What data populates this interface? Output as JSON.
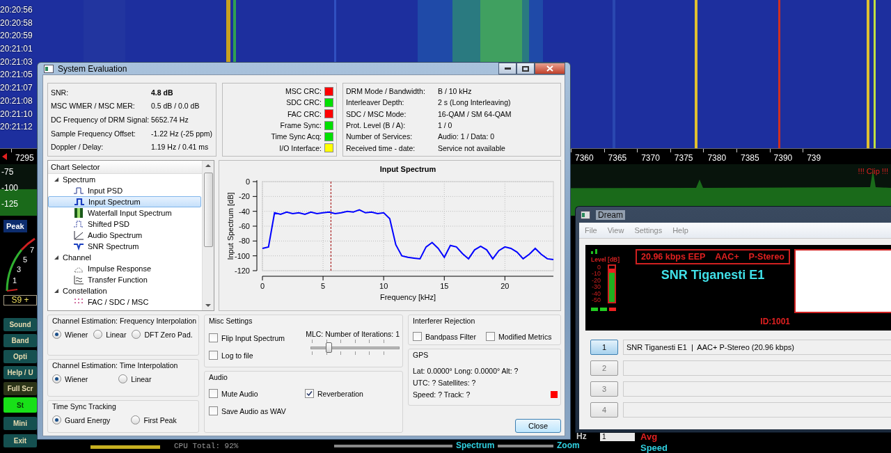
{
  "background": {
    "time_labels": [
      "20:20:56",
      "20:20:58",
      "20:20:59",
      "20:21:01",
      "20:21:03",
      "20:21:05",
      "20:21:07",
      "20:21:08",
      "20:21:10",
      "20:21:12"
    ],
    "frequency_labels": [
      "7295",
      "7360",
      "7365",
      "7370",
      "7375",
      "7380",
      "7385",
      "7390",
      "739"
    ],
    "level_labels": [
      "-75",
      "-100",
      "-125"
    ],
    "clip_warning": "!!! Clip !!!",
    "peak_button": "Peak",
    "dial_labels": [
      "7",
      "5",
      "3",
      "1"
    ],
    "s_reading": "S9 +",
    "side_buttons": [
      {
        "label": "Sound",
        "kind": "normal"
      },
      {
        "label": "Band",
        "kind": "normal"
      },
      {
        "label": "Opti",
        "kind": "normal"
      },
      {
        "label": "Help / U",
        "kind": "normal"
      },
      {
        "label": "Full Scr",
        "kind": "dark"
      },
      {
        "label": "St",
        "kind": "active"
      },
      {
        "label": "Mini",
        "kind": "normal"
      },
      {
        "label": "Exit",
        "kind": "normal"
      }
    ],
    "cpu": "CPU Total: 92%",
    "spectrum_label": "Spectrum",
    "zoom_label": "Zoom",
    "hz_label": "Hz",
    "avg_select": "1",
    "avg_label": "Avg",
    "speed_label": "Speed"
  },
  "system_evaluation": {
    "title": "System Evaluation",
    "measurements": [
      {
        "label": "SNR:",
        "value": "4.8 dB",
        "bold": true
      },
      {
        "label": "MSC WMER / MSC MER:",
        "value": "0.5 dB / 0.0 dB",
        "bold": false
      },
      {
        "label": "DC Frequency of DRM Signal:",
        "value": "5652.74 Hz",
        "bold": false
      },
      {
        "label": "Sample Frequency Offset:",
        "value": "-1.22 Hz (-25 ppm)",
        "bold": false
      },
      {
        "label": "Doppler / Delay:",
        "value": "1.19 Hz / 0.41 ms",
        "bold": false
      }
    ],
    "indicators": [
      {
        "label": "MSC CRC:",
        "color": "#ff0000"
      },
      {
        "label": "SDC CRC:",
        "color": "#00e000"
      },
      {
        "label": "FAC CRC:",
        "color": "#ff0000"
      },
      {
        "label": "Frame Sync:",
        "color": "#00e000"
      },
      {
        "label": "Time Sync Acq:",
        "color": "#00e000"
      },
      {
        "label": "I/O Interface:",
        "color": "#ffff00"
      }
    ],
    "drm_info": [
      {
        "label": "DRM Mode / Bandwidth:",
        "value": "B / 10 kHz"
      },
      {
        "label": "Interleaver Depth:",
        "value": "2 s (Long Interleaving)"
      },
      {
        "label": "SDC / MSC Mode:",
        "value": "16-QAM / SM 64-QAM"
      },
      {
        "label": "Prot. Level (B / A):",
        "value": "1 / 0"
      },
      {
        "label": "Number of Services:",
        "value": "Audio: 1 / Data: 0"
      },
      {
        "label": "Received time - date:",
        "value": "Service not available"
      }
    ],
    "chart_selector": {
      "title": "Chart Selector",
      "tree": [
        {
          "label": "Spectrum",
          "expanded": true,
          "children": [
            {
              "label": "Input PSD",
              "selected": false
            },
            {
              "label": "Input Spectrum",
              "selected": true
            },
            {
              "label": "Waterfall Input Spectrum",
              "selected": false
            },
            {
              "label": "Shifted PSD",
              "selected": false
            },
            {
              "label": "Audio Spectrum",
              "selected": false
            },
            {
              "label": "SNR Spectrum",
              "selected": false
            }
          ]
        },
        {
          "label": "Channel",
          "expanded": true,
          "children": [
            {
              "label": "Impulse Response",
              "selected": false
            },
            {
              "label": "Transfer Function",
              "selected": false
            }
          ]
        },
        {
          "label": "Constellation",
          "expanded": true,
          "children": [
            {
              "label": "FAC / SDC / MSC",
              "selected": false
            }
          ]
        }
      ]
    },
    "chart": {
      "chart_data": {
        "type": "line",
        "title": "Input Spectrum",
        "xlabel": "Frequency [kHz]",
        "ylabel": "Input Spectrum [dB]",
        "x": [
          0,
          0.5,
          1,
          1.5,
          2,
          2.5,
          3,
          3.5,
          4,
          4.5,
          5,
          5.5,
          6,
          6.5,
          7,
          7.5,
          8,
          8.5,
          9,
          9.5,
          10,
          10.5,
          11,
          11.5,
          12,
          12.5,
          13,
          13.5,
          14,
          14.5,
          15,
          15.5,
          16,
          16.5,
          17,
          17.5,
          18,
          18.5,
          19,
          19.5,
          20,
          20.5,
          21,
          21.5,
          22,
          22.5,
          23,
          23.5,
          24
        ],
        "series": [
          {
            "color": "#0000ff",
            "values": [
              -90,
              -88,
              -42,
              -44,
              -41,
              -43,
              -42,
              -44,
              -41,
              -43,
              -42,
              -41,
              -43,
              -42,
              -40,
              -41,
              -38,
              -42,
              -41,
              -43,
              -42,
              -50,
              -85,
              -100,
              -102,
              -103,
              -104,
              -88,
              -82,
              -90,
              -102,
              -86,
              -88,
              -97,
              -104,
              -92,
              -87,
              -92,
              -104,
              -93,
              -88,
              -90,
              -95,
              -104,
              -98,
              -90,
              -98,
              -104,
              -105
            ]
          }
        ],
        "xlim": [
          0,
          24
        ],
        "ylim": [
          -120,
          0
        ],
        "xticks": [
          0,
          5,
          10,
          15,
          20
        ],
        "yticks": [
          0,
          -20,
          -40,
          -60,
          -80,
          -100,
          -120
        ],
        "grid": true,
        "ref_lines": [
          {
            "axis": "x",
            "value": 5.65
          }
        ]
      }
    },
    "freq_interpolation": {
      "title": "Channel Estimation: Frequency Interpolation",
      "options": [
        {
          "label": "Wiener",
          "selected": true
        },
        {
          "label": "Linear",
          "selected": false
        },
        {
          "label": "DFT Zero Pad.",
          "selected": false
        }
      ]
    },
    "time_interpolation": {
      "title": "Channel Estimation: Time Interpolation",
      "options": [
        {
          "label": "Wiener",
          "selected": true
        },
        {
          "label": "Linear",
          "selected": false
        }
      ]
    },
    "time_sync": {
      "title": "Time Sync Tracking",
      "options": [
        {
          "label": "Guard Energy",
          "selected": true
        },
        {
          "label": "First Peak",
          "selected": false
        }
      ]
    },
    "misc": {
      "title": "Misc Settings",
      "checkboxes": [
        {
          "label": "Flip Input Spectrum",
          "checked": false
        },
        {
          "label": "Log to file",
          "checked": false
        }
      ],
      "slider": {
        "label": "MLC: Number of Iterations: 1",
        "level": 0.2
      }
    },
    "audio": {
      "title": "Audio",
      "checkboxes": [
        {
          "label": "Mute Audio",
          "checked": false
        },
        {
          "label": "Reverberation",
          "checked": true
        },
        {
          "label": "Save Audio as WAV",
          "checked": false
        }
      ]
    },
    "interferer": {
      "title": "Interferer Rejection",
      "checkboxes": [
        {
          "label": "Bandpass Filter",
          "checked": false
        },
        {
          "label": "Modified Metrics",
          "checked": false
        }
      ]
    },
    "gps": {
      "title": "GPS",
      "lines": [
        "Lat: 0.0000° Long: 0.0000° Alt: ?",
        "UTC: ? Satellites: ?",
        "Speed: ? Track: ?"
      ],
      "status": {
        "color": "#ff0000"
      }
    },
    "close_button": "Close"
  },
  "dream": {
    "title": "Dream",
    "menu": [
      "File",
      "View",
      "Settings",
      "Help"
    ],
    "level_label": "Level [dB]",
    "level_scale": [
      "0",
      "-10",
      "-20",
      "-30",
      "-40",
      "-50"
    ],
    "level": 0.8,
    "status_leds": [
      {
        "color": "#22cc22"
      },
      {
        "color": "#22cc22"
      },
      {
        "color": "#ee2222"
      }
    ],
    "status_texts": [
      "20.96 kbps EEP",
      "AAC+",
      "P-Stereo"
    ],
    "station": "SNR Tiganesti E1",
    "service_id": "ID:1001",
    "services": [
      {
        "number": "1",
        "label": "SNR Tiganesti E1  |  AAC+ P-Stereo (20.96 kbps)",
        "selected": true
      },
      {
        "number": "2",
        "selected": false
      },
      {
        "number": "3",
        "selected": false
      },
      {
        "number": "4",
        "selected": false
      }
    ]
  }
}
